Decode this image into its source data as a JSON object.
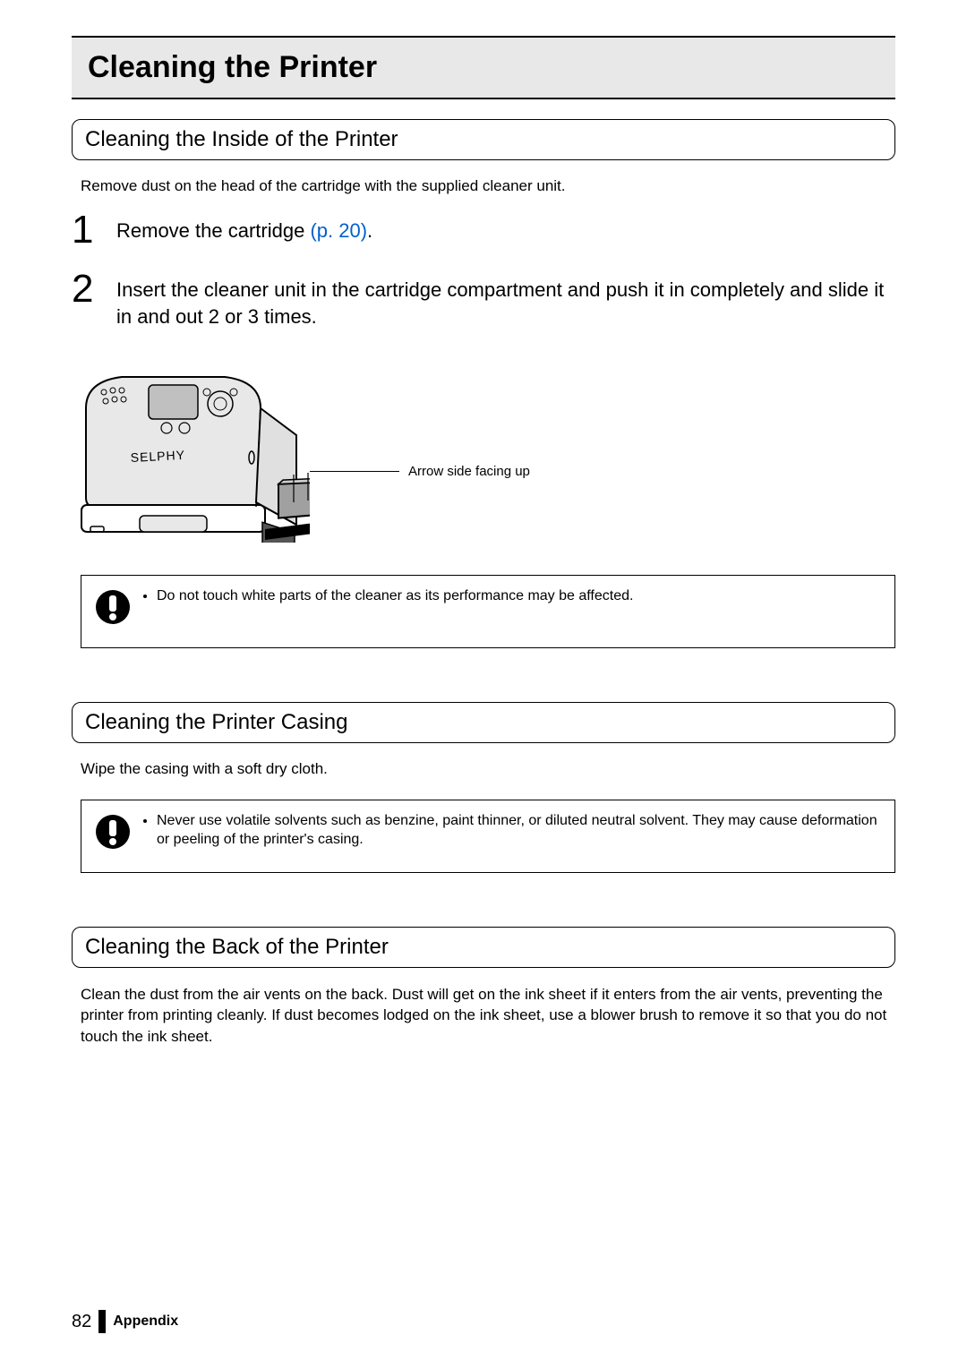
{
  "title": "Cleaning the Printer",
  "section1": {
    "heading": "Cleaning the Inside of the Printer",
    "intro": "Remove dust on the head of the cartridge with the supplied cleaner unit.",
    "steps": [
      {
        "number": "1",
        "text": "Remove the cartridge ",
        "linkText": "(p. 20)",
        "tail": "."
      },
      {
        "number": "2",
        "text": "Insert the cleaner unit in the cartridge compartment and push it in completely and slide it in and out 2 or 3 times.",
        "linkText": "",
        "tail": ""
      }
    ],
    "calloutLabel": "Arrow side facing up",
    "illustrationLabel": "SELPHY",
    "caution": "Do not touch white parts of the cleaner as its performance may be affected."
  },
  "section2": {
    "heading": "Cleaning the Printer Casing",
    "intro": "Wipe the casing with a soft dry cloth.",
    "caution": "Never use volatile solvents such as benzine, paint thinner, or diluted neutral solvent. They may cause deformation or peeling of the printer's casing."
  },
  "section3": {
    "heading": "Cleaning the Back of the Printer",
    "intro": "Clean the dust from the air vents on the back. Dust will get on the ink sheet if it enters from the air vents, preventing the printer from printing cleanly. If dust becomes lodged on the ink sheet, use a blower brush to remove it so that you do not touch the ink sheet."
  },
  "footer": {
    "pageNumber": "82",
    "appendix": "Appendix"
  }
}
